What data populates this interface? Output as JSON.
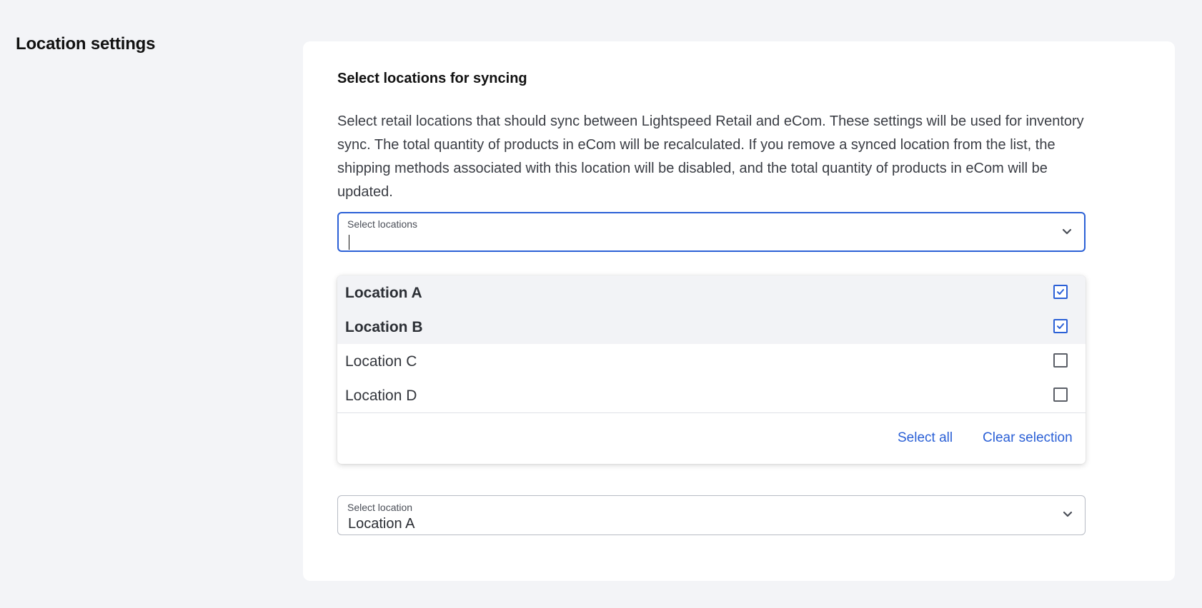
{
  "section": {
    "title": "Location settings"
  },
  "card": {
    "heading": "Select locations for syncing",
    "description": "Select retail locations that should sync between Lightspeed Retail and eCom. These settings will be used for inventory sync. The total quantity of products in eCom will be recalculated. If you remove a synced location from the list, the shipping methods associated with this location will be disabled, and the total quantity of products in eCom will be updated."
  },
  "locations_select": {
    "label": "Select locations",
    "value": "",
    "icon": "chevron-down-icon",
    "options": [
      {
        "label": "Location A",
        "checked": true
      },
      {
        "label": "Location B",
        "checked": true
      },
      {
        "label": "Location C",
        "checked": false
      },
      {
        "label": "Location D",
        "checked": false
      }
    ],
    "select_all_label": "Select all",
    "clear_label": "Clear selection"
  },
  "location_select": {
    "label": "Select location",
    "value": "Location A",
    "icon": "chevron-down-icon"
  },
  "colors": {
    "accent": "#2b60d6",
    "page_bg": "#f3f4f7",
    "card_bg": "#ffffff",
    "selected_row_bg": "#f2f3f6"
  }
}
